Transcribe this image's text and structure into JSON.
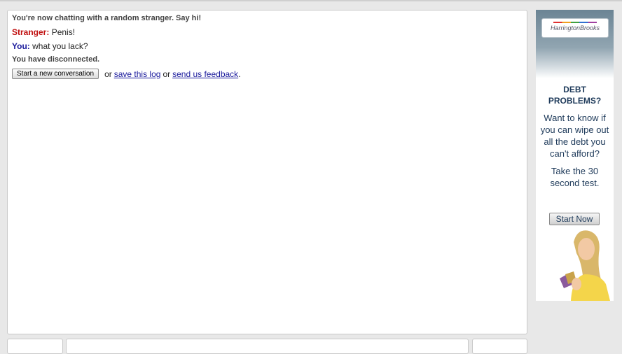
{
  "chat": {
    "status_connected": "You're now chatting with a random stranger. Say hi!",
    "messages": [
      {
        "speaker": "Stranger:",
        "text": "Penis!"
      },
      {
        "speaker": "You:",
        "text": "what you lack?"
      }
    ],
    "status_disconnected": "You have disconnected.",
    "actions": {
      "new_conversation_button": "Start a new conversation",
      "or1": "or",
      "save_log_link": "save this log",
      "or2": "or",
      "feedback_link": "send us feedback",
      "period": "."
    }
  },
  "ad": {
    "logo_text": "HarringtonBrooks",
    "heading": "DEBT PROBLEMS?",
    "body": "Want to know if you can wipe out all the debt you can't afford?",
    "cta_text": "Take the 30 second test.",
    "button_label": "Start Now",
    "brand_colors": {
      "text": "#1e3a5a",
      "header": "#6b8494"
    }
  }
}
